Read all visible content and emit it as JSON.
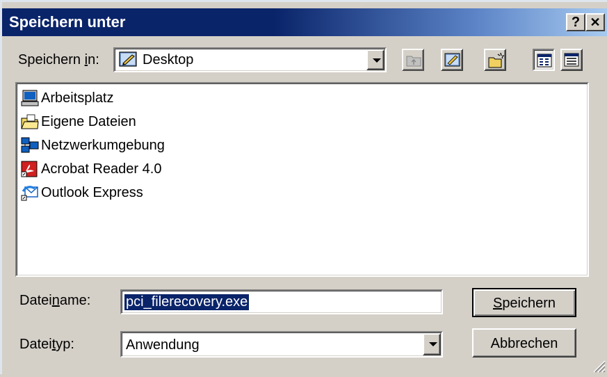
{
  "dialog": {
    "title": "Speichern unter",
    "help_button": "?",
    "close_button": "✕"
  },
  "save_in": {
    "label_pre": "Speichern ",
    "label_ul": "i",
    "label_post": "n:",
    "value": "Desktop",
    "icon": "desktop-icon"
  },
  "toolbar": {
    "icons": [
      "up-folder-icon",
      "desktop-icon",
      "new-folder-icon",
      "list-view-icon",
      "details-view-icon"
    ]
  },
  "files": [
    {
      "name": "Arbeitsplatz",
      "icon": "computer-icon"
    },
    {
      "name": "Eigene Dateien",
      "icon": "folder-icon"
    },
    {
      "name": "Netzwerkumgebung",
      "icon": "network-icon"
    },
    {
      "name": "Acrobat Reader 4.0",
      "icon": "acrobat-icon"
    },
    {
      "name": "Outlook Express",
      "icon": "outlook-icon"
    }
  ],
  "filename": {
    "label_pre": "Datei",
    "label_ul": "n",
    "label_post": "ame:",
    "value": "pci_filerecovery.exe"
  },
  "filetype": {
    "label_pre": "Datei",
    "label_ul": "t",
    "label_post": "yp:",
    "value": "Anwendung"
  },
  "buttons": {
    "save_ul": "S",
    "save_rest": "peichern",
    "cancel": "Abbrechen"
  },
  "colors": {
    "titlebar_start": "#0a246a",
    "titlebar_end": "#a6caf0",
    "face": "#d4d0c8",
    "selection": "#0a246a"
  }
}
